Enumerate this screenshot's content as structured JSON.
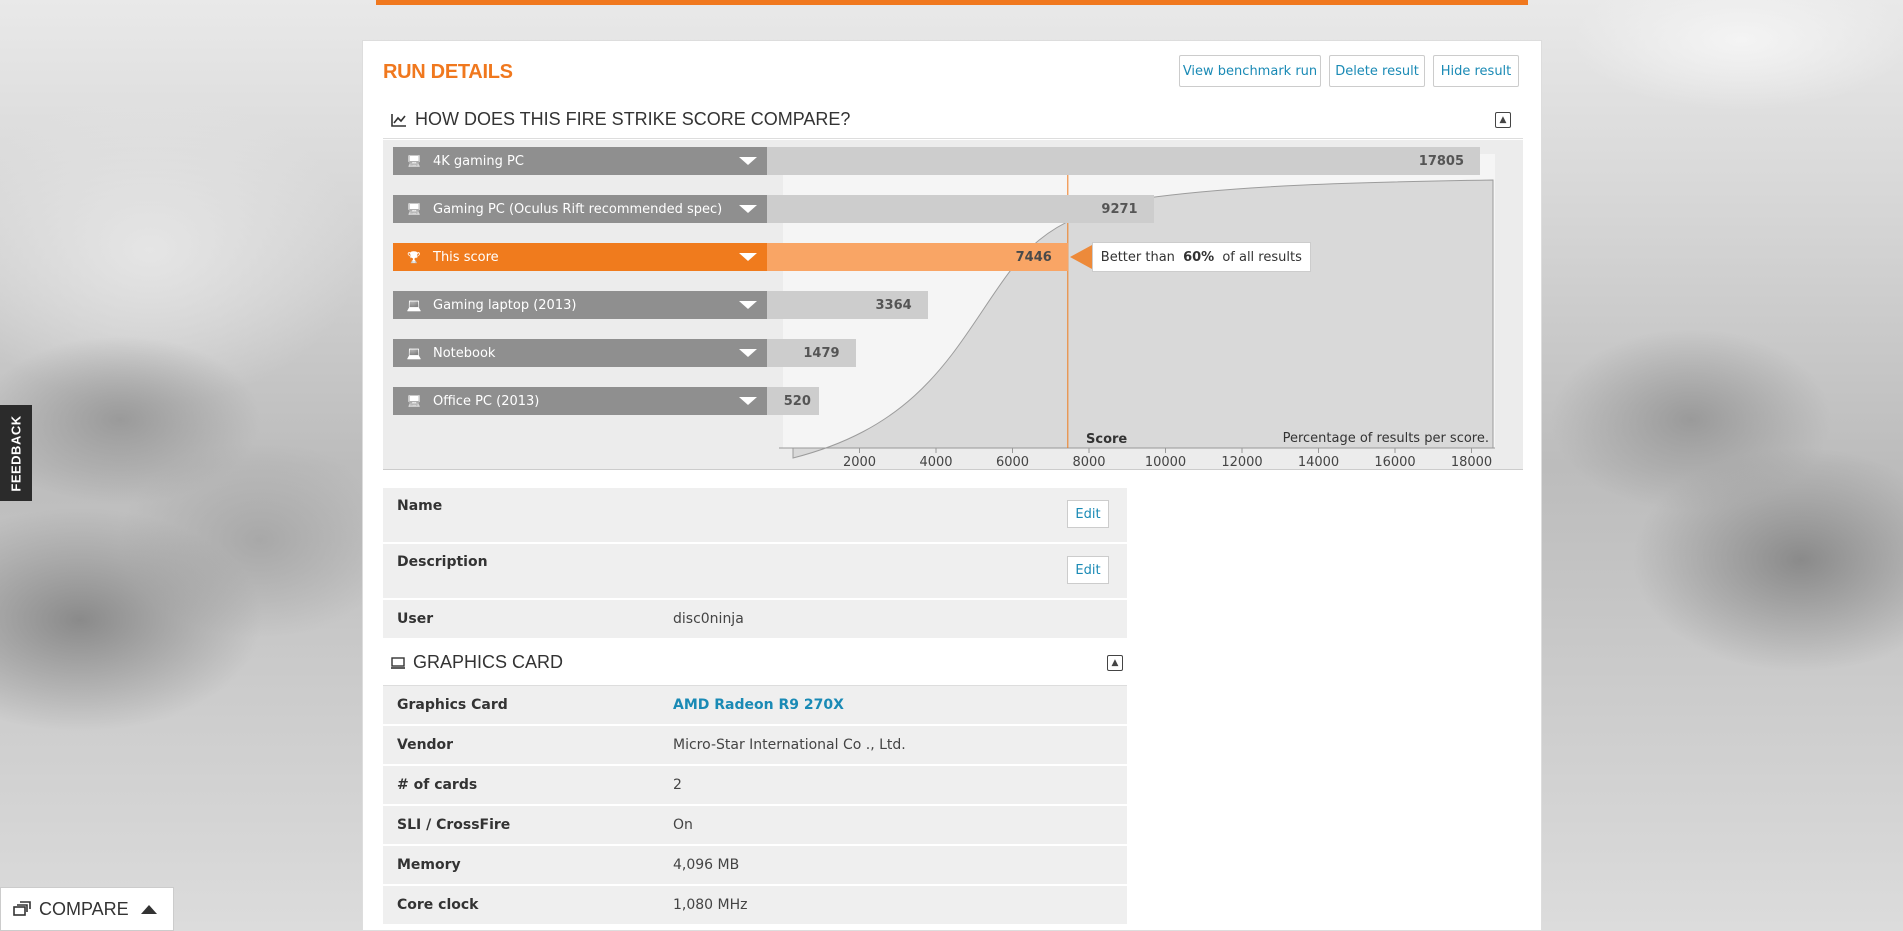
{
  "header": {
    "run_title": "RUN DETAILS",
    "view_run_label": "View benchmark run",
    "delete_label": "Delete result",
    "hide_label": "Hide result"
  },
  "compare_section": {
    "title": "HOW DOES THIS FIRE STRIKE SCORE COMPARE?",
    "tooltip_prefix": "Better than ",
    "tooltip_percent": "60%",
    "tooltip_suffix": " of all results",
    "score_axis_label": "Score",
    "distribution_label": "Percentage of results per score."
  },
  "chart_data": {
    "type": "bar",
    "categories": [
      "4K gaming PC",
      "Gaming PC (Oculus Rift recommended spec)",
      "This score",
      "Gaming laptop (2013)",
      "Notebook",
      "Office PC (2013)"
    ],
    "values": [
      17805,
      9271,
      7446,
      3364,
      1479,
      520
    ],
    "value_labels": [
      "17805",
      "9271",
      "7446",
      "3364",
      "1479",
      "520"
    ],
    "highlight_index": 2,
    "x_ticks": [
      "2000",
      "4000",
      "6000",
      "8000",
      "10000",
      "12000",
      "14000",
      "16000",
      "18000"
    ],
    "xlim": [
      0,
      20000
    ],
    "highlight_color": "#f07b1d",
    "bar_color": "#cdcdcd"
  },
  "details": {
    "name_label": "Name",
    "description_label": "Description",
    "user_label": "User",
    "user_value": "disc0ninja",
    "edit_label": "Edit"
  },
  "graphics_card": {
    "title": "GRAPHICS CARD",
    "rows": [
      {
        "k": "Graphics Card",
        "v": "AMD Radeon R9 270X"
      },
      {
        "k": "Vendor",
        "v": "Micro-Star International Co ., Ltd."
      },
      {
        "k": "# of cards",
        "v": "2"
      },
      {
        "k": "SLI / CrossFire",
        "v": "On"
      },
      {
        "k": "Memory",
        "v": "4,096 MB"
      },
      {
        "k": "Core clock",
        "v": "1,080 MHz"
      }
    ]
  },
  "sidebar": {
    "feedback_label": "FEEDBACK",
    "compare_label": "COMPARE"
  },
  "colors": {
    "accent": "#f07b1d",
    "link": "#1a8ab5"
  }
}
